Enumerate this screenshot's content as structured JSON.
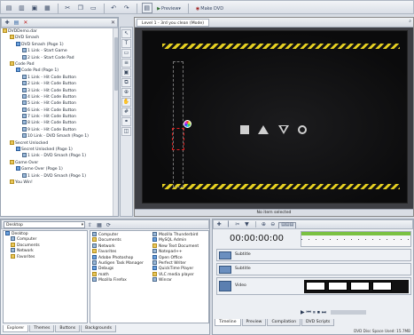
{
  "toolbar": {
    "preview_label": "Preview",
    "make_label": "Make DVD"
  },
  "tree": {
    "root": "DVDDemo.dar",
    "items": [
      "DVD Smash",
      "DVD Smash (Page 1)",
      "1 Link - Start Game",
      "2 Link - Start Code Pad",
      "Code Pad",
      "Code Pad (Page 1)",
      "1 Link - Hit Code Button",
      "2 Link - Hit Code Button",
      "3 Link - Hit Code Button",
      "4 Link - Hit Code Button",
      "5 Link - Hit Code Button",
      "6 Link - Hit Code Button",
      "7 Link - Hit Code Button",
      "8 Link - Hit Code Button",
      "9 Link - Hit Code Button",
      "10 Link - DVD Smash (Page 1)",
      "Secret Unlocked",
      "Secret Unlocked (Page 1)",
      "1 Link - DVD Smash (Page 1)",
      "Game Over",
      "Game Over (Page 1)",
      "1 Link - DVD Smash (Page 1)",
      "You Win!"
    ]
  },
  "canvas": {
    "tab_label": "Level 1 - 3rd you clean (Mode)",
    "status": "No item selected",
    "shapes": [
      "■",
      "▲",
      "▽",
      "○"
    ]
  },
  "explorer": {
    "location": "Desktop",
    "folders": [
      "Desktop",
      "Computer",
      "Documents",
      "Network",
      "Favorites"
    ],
    "files_col1": [
      "Computer",
      "Documents",
      "Network",
      "Favorites",
      "Adobe Photoshop",
      "Audigen Task Manager",
      "Debugs",
      "math",
      "Mozilla Firefox"
    ],
    "files_col2": [
      "Mozilla Thunderbird",
      "MySQL Admin",
      "New Text Document",
      "Notepad++",
      "Open Office",
      "Perfect Writer",
      "QuickTime Player",
      "VLC media player",
      "Winrar"
    ],
    "tabs": [
      "Explorer",
      "Themes",
      "Buttons",
      "Backgrounds"
    ]
  },
  "timeline": {
    "timecode": "00:00:00:00",
    "tracks": [
      "Subtitle",
      "Subtitle",
      "Video"
    ],
    "tabs": [
      "Timeline",
      "Preview",
      "Compilation",
      "DVD Scripts"
    ],
    "status": "DVD Disc Space Used: 15.7MB"
  },
  "colors": {
    "accent": "#3a6ea5",
    "canvas_bg": "#3e3f44",
    "stage_bg": "#0f0f10",
    "hazard_yellow": "#e5d021"
  }
}
